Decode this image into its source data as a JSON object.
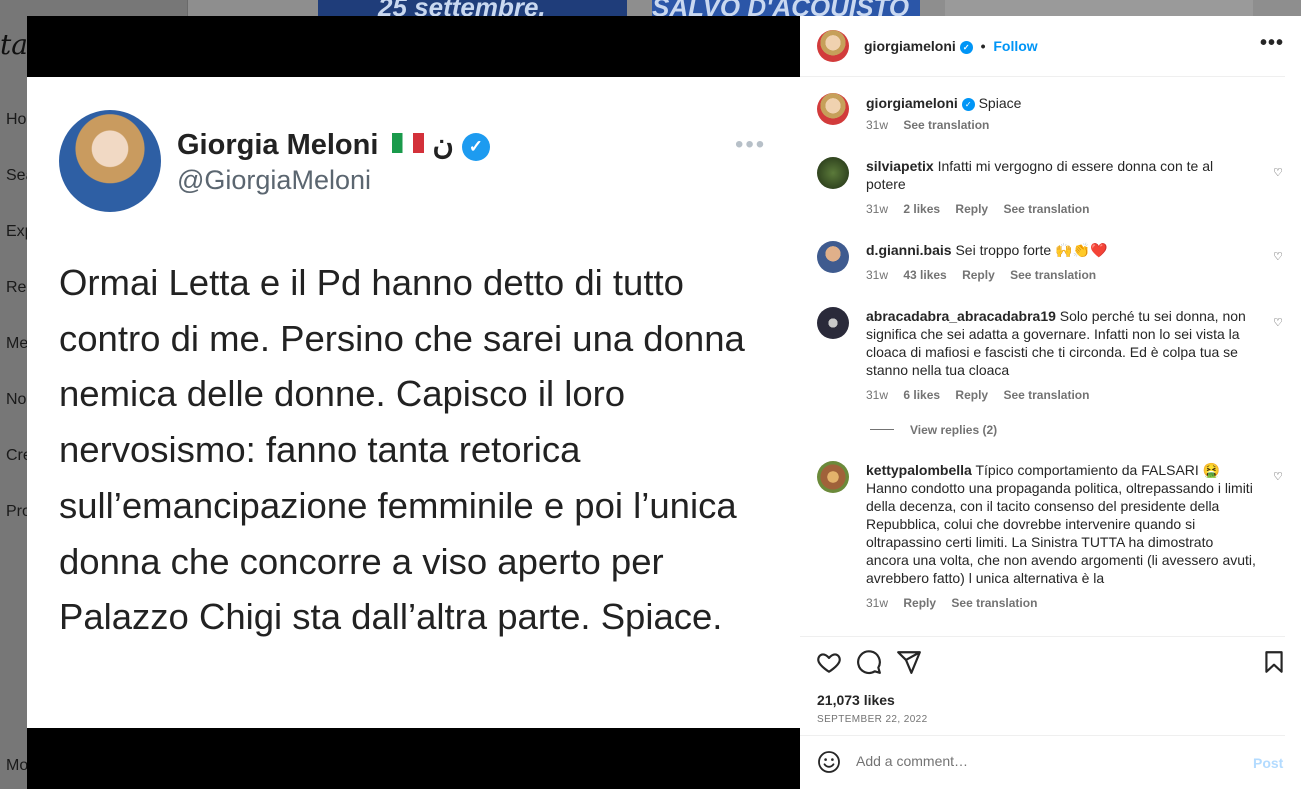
{
  "background": {
    "logo": "tag",
    "nav": [
      "Ho",
      "Sea",
      "Exp",
      "Ree",
      "Me",
      "No",
      "Cre",
      "Pro",
      "Mo"
    ],
    "thumbs": [
      "25 settembre.",
      "SALVO D'ACQUISTO",
      ""
    ]
  },
  "tweet": {
    "name": "Giorgia Meloni",
    "name_suffix": "ن",
    "handle": "@GiorgiaMeloni",
    "text": "Ormai Letta e il Pd hanno detto di tutto contro di me. Persino che sarei una donna nemica delle donne. Capisco il loro nervosismo: fanno tanta retorica sull’emancipazione femminile e poi l’unica donna che concorre a viso aperto per Palazzo Chigi sta dall’altra parte. Spiace."
  },
  "header": {
    "username": "giorgiameloni",
    "follow_label": "Follow"
  },
  "caption": {
    "username": "giorgiameloni",
    "text": "Spiace",
    "time": "31w",
    "see_translation": "See translation"
  },
  "comments": [
    {
      "username": "silviapetix",
      "text": "Infatti mi vergogno di essere donna con te al potere",
      "time": "31w",
      "likes": "2 likes",
      "reply": "Reply",
      "see_translation": "See translation"
    },
    {
      "username": "d.gianni.bais",
      "text": "Sei troppo forte 🙌👏❤️",
      "time": "31w",
      "likes": "43 likes",
      "reply": "Reply",
      "see_translation": "See translation"
    },
    {
      "username": "abracadabra_abracadabra19",
      "text": "Solo perché tu sei donna, non significa che sei adatta a governare. Infatti non lo sei vista la cloaca di mafiosi e fascisti che ti circonda. Ed è colpa tua se stanno nella tua cloaca",
      "time": "31w",
      "likes": "6 likes",
      "reply": "Reply",
      "see_translation": "See translation",
      "view_replies": "View replies (2)"
    },
    {
      "username": "kettypalombella",
      "text": "Típico comportamiento da FALSARI 🤮 Hanno condotto una propaganda politica, oltrepassando i limiti della decenza, con il tacito consenso del presidente della Repubblica, colui che dovrebbe intervenire quando si oltrapassino certi limiti. La Sinistra TUTTA ha dimostrato ancora una volta, che non avendo argomenti (li avessero avuti, avrebbero fatto) l unica alternativa è la",
      "time": "31w",
      "reply": "Reply",
      "see_translation": "See translation"
    }
  ],
  "footer": {
    "likes": "21,073 likes",
    "date": "SEPTEMBER 22, 2022",
    "comment_placeholder": "Add a comment…",
    "post_label": "Post"
  },
  "colors": {
    "accent": "#0095f6",
    "post_disabled": "#b3dbff",
    "verified": "#1d9bf0"
  }
}
